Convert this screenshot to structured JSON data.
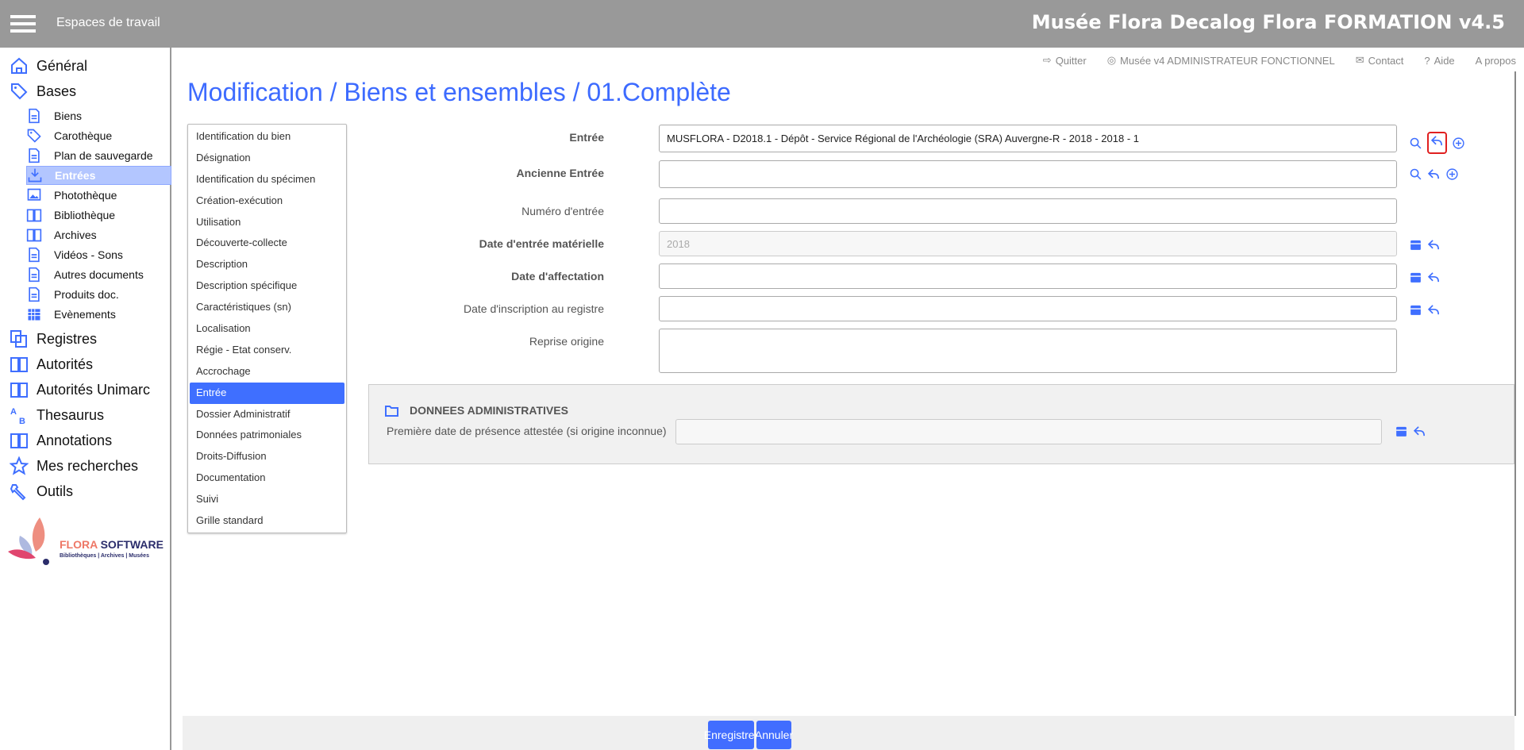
{
  "header": {
    "workspaces": "Espaces de travail",
    "app_title": "Musée Flora Decalog Flora FORMATION v4.5"
  },
  "toplinks": {
    "quit": "Quitter",
    "user": "Musée v4 ADMINISTRATEUR FONCTIONNEL",
    "contact": "Contact",
    "help": "Aide",
    "about": "A propos"
  },
  "sidebar": {
    "general": "Général",
    "bases": "Bases",
    "sub": [
      "Biens",
      "Carothèque",
      "Plan de sauvegarde",
      "Entrées",
      "Photothèque",
      "Bibliothèque",
      "Archives",
      "Vidéos - Sons",
      "Autres documents",
      "Produits doc.",
      "Evènements"
    ],
    "active_sub": "Entrées",
    "more": [
      "Registres",
      "Autorités",
      "Autorités Unimarc",
      "Thesaurus",
      "Annotations",
      "Mes recherches",
      "Outils"
    ],
    "logo": {
      "brand1": "FLORA",
      "brand2": "SOFTWARE",
      "tagline": "Bibliothèques | Archives | Musées"
    }
  },
  "page_title": "Modification / Biens et ensembles / 01.Complète",
  "nav": {
    "items": [
      "Identification du bien",
      "Désignation",
      "Identification du spécimen",
      "Création-exécution",
      "Utilisation",
      "Découverte-collecte",
      "Description",
      "Description spécifique",
      "Caractéristiques (sn)",
      "Localisation",
      "Régie - Etat conserv.",
      "Accrochage",
      "Entrée",
      "Dossier Administratif",
      "Données patrimoniales",
      "Droits-Diffusion",
      "Documentation",
      "Suivi",
      "Grille standard"
    ],
    "active": "Entrée"
  },
  "form": {
    "entree": {
      "label": "Entrée",
      "value": "MUSFLORA - D2018.1 - Dépôt - Service Régional de l'Archéologie (SRA) Auvergne-R - 2018 - 2018 - 1"
    },
    "ancienne": {
      "label": "Ancienne Entrée",
      "value": ""
    },
    "numero": {
      "label": "Numéro d'entrée",
      "value": ""
    },
    "date_mat": {
      "label": "Date d'entrée matérielle",
      "value": "2018"
    },
    "date_aff": {
      "label": "Date d'affectation",
      "value": ""
    },
    "date_insc": {
      "label": "Date d'inscription au registre",
      "value": ""
    },
    "reprise": {
      "label": "Reprise origine",
      "value": ""
    }
  },
  "admin": {
    "heading": "DONNEES ADMINISTRATIVES",
    "field_label": "Première date de présence attestée (si origine inconnue)",
    "value": ""
  },
  "footer": {
    "save": "Enregistrer",
    "cancel": "Annuler"
  },
  "colors": {
    "accent": "#3f6fff",
    "header": "#999999",
    "highlight": "#e02020"
  }
}
